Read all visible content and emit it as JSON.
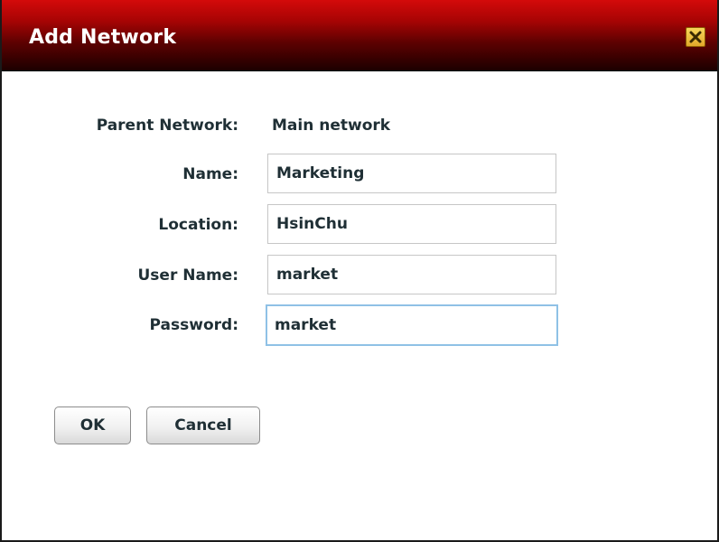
{
  "dialog": {
    "title": "Add Network",
    "close_icon": "close-icon",
    "accent": "#c00000"
  },
  "form": {
    "parent_network": {
      "label": "Parent Network:",
      "value": "Main network"
    },
    "name": {
      "label": "Name:",
      "value": "Marketing"
    },
    "location": {
      "label": "Location:",
      "value": "HsinChu"
    },
    "user_name": {
      "label": "User Name:",
      "value": "market"
    },
    "password": {
      "label": "Password:",
      "value": "market"
    }
  },
  "buttons": {
    "ok": "OK",
    "cancel": "Cancel"
  }
}
